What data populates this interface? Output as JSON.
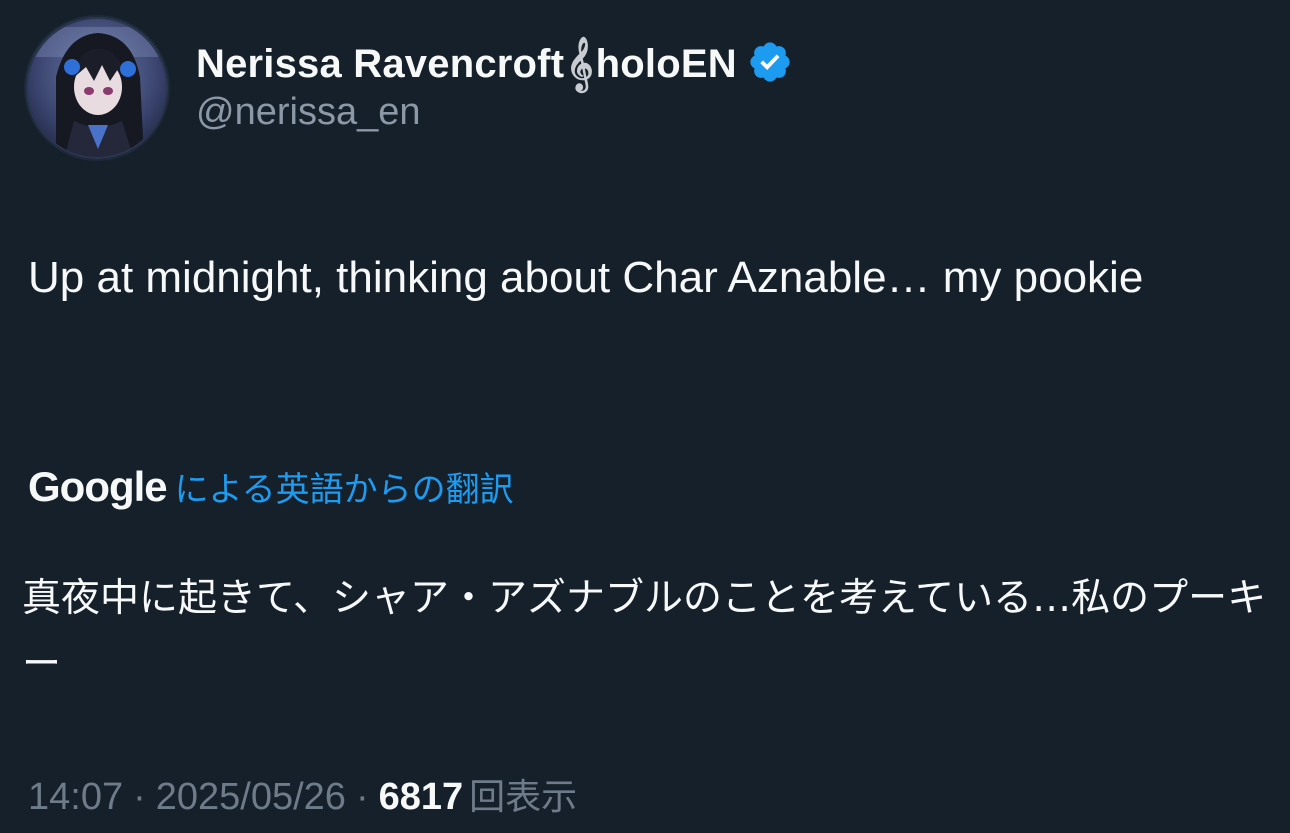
{
  "author": {
    "display_name_part1": "Nerissa Ravencroft",
    "name_icon": "treble-clef-icon",
    "display_name_part2": "holoEN",
    "verified": true,
    "handle": "@nerissa_en"
  },
  "tweet": {
    "text": "Up at midnight, thinking about Char Aznable… my pookie"
  },
  "translation": {
    "provider": "Google",
    "label": "による英語からの翻訳",
    "text": "真夜中に起きて、シャア・アズナブルのことを考えている…私のプーキー"
  },
  "meta": {
    "time": "14:07",
    "separator": "·",
    "date": "2025/05/26",
    "views_count": "6817",
    "views_label": "回表示"
  },
  "colors": {
    "background": "#15202b",
    "link_blue": "#1d9bf0",
    "secondary_text": "#8b98a5",
    "verified_badge": "#1d9bf0"
  }
}
